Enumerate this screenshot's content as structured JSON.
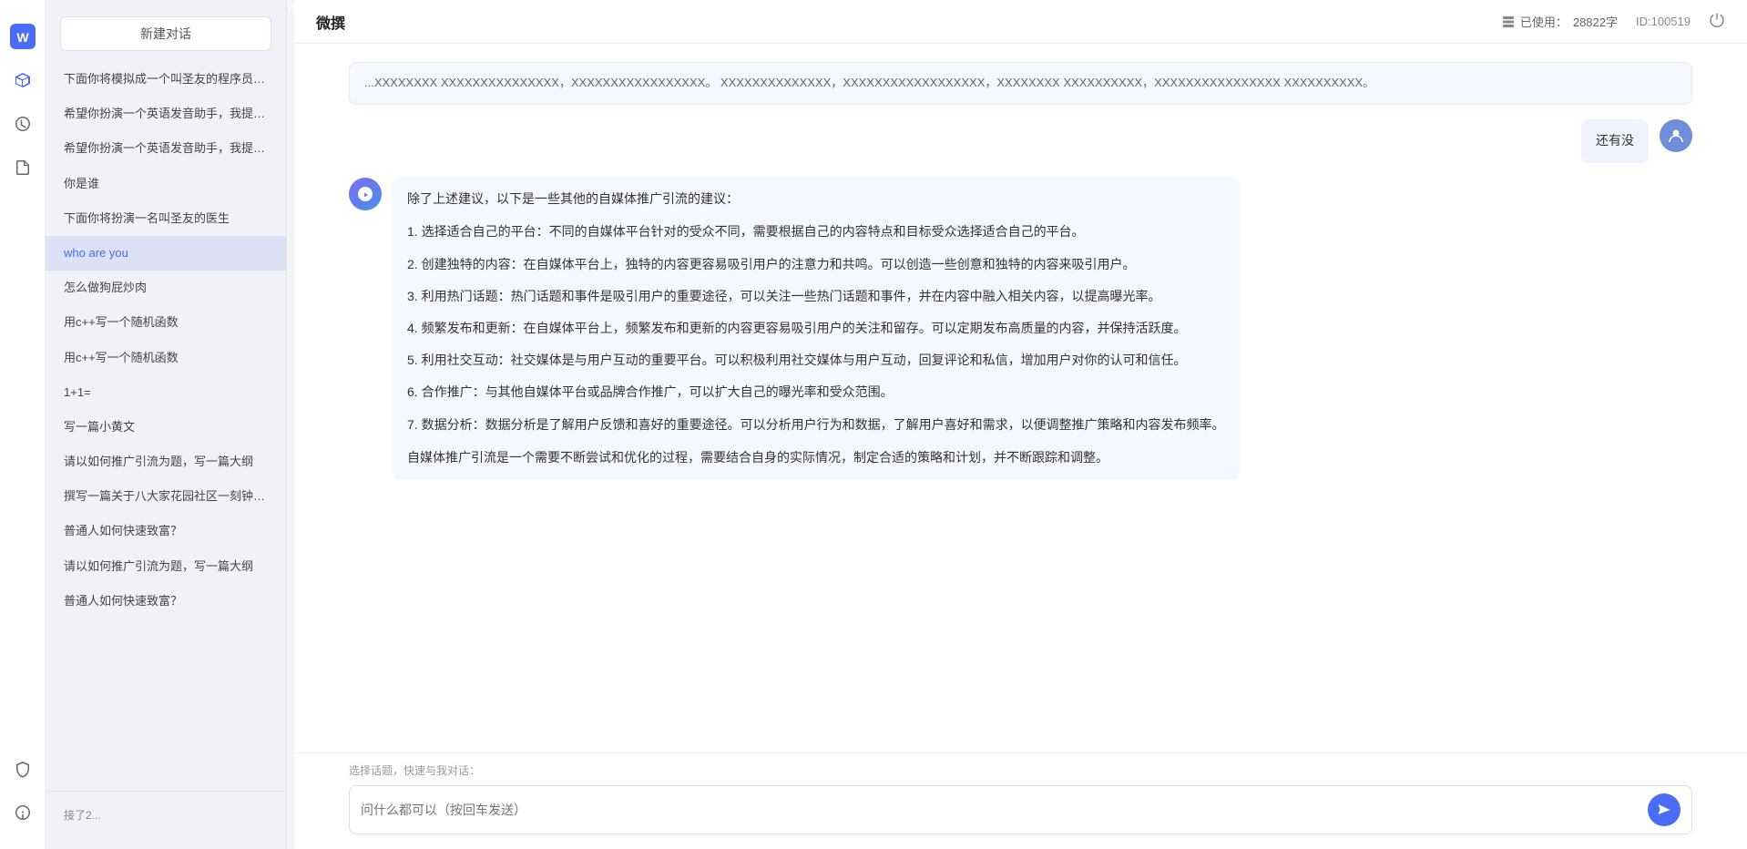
{
  "app": {
    "title": "微撰",
    "usage_label": "已使用：",
    "usage_value": "28822字",
    "id_label": "ID:100519"
  },
  "header": {
    "title": "微撰"
  },
  "sidebar": {
    "new_chat_label": "新建对话",
    "items": [
      {
        "id": 1,
        "text": "下面你将模拟成一个叫圣友的程序员，我说..."
      },
      {
        "id": 2,
        "text": "希望你扮演一个英语发音助手，我提供给你..."
      },
      {
        "id": 3,
        "text": "希望你扮演一个英语发音助手，我提供给你..."
      },
      {
        "id": 4,
        "text": "你是谁"
      },
      {
        "id": 5,
        "text": "下面你将扮演一名叫圣友的医生"
      },
      {
        "id": 6,
        "text": "who are you",
        "active": true
      },
      {
        "id": 7,
        "text": "怎么做狗屁炒肉"
      },
      {
        "id": 8,
        "text": "用c++写一个随机函数"
      },
      {
        "id": 9,
        "text": "用c++写一个随机函数"
      },
      {
        "id": 10,
        "text": "1+1="
      },
      {
        "id": 11,
        "text": "写一篇小黄文"
      },
      {
        "id": 12,
        "text": "请以如何推广引流为题，写一篇大纲"
      },
      {
        "id": 13,
        "text": "撰写一篇关于八大家花园社区一刻钟便民生..."
      },
      {
        "id": 14,
        "text": "普通人如何快速致富？"
      },
      {
        "id": 15,
        "text": "请以如何推广引流为题，写一篇大纲"
      },
      {
        "id": 16,
        "text": "普通人如何快速致富？"
      }
    ],
    "bottom_items": [
      {
        "id": "b1",
        "text": "接了2..."
      }
    ]
  },
  "chat": {
    "partial_text": "...XXXXXXXX XXXXXXXXXXXXXXX，XXXXXXXXXXXXXXXXX。 XXXXXXXXXXXXXX，XXXXXXXXXXXXXXXXXX，XXXXXXXX XXXXXXXXXX，XXXXXXXXXXXXXXXX XXXXXXXXXX。",
    "user_message": "还有没",
    "ai_response": {
      "intro": "除了上述建议，以下是一些其他的自媒体推广引流的建议：",
      "points": [
        "1. 选择适合自己的平台：不同的自媒体平台针对的受众不同，需要根据自己的内容特点和目标受众选择适合自己的平台。",
        "2. 创建独特的内容：在自媒体平台上，独特的内容更容易吸引用户的注意力和共鸣。可以创造一些创意和独特的内容来吸引用户。",
        "3. 利用热门话题：热门话题和事件是吸引用户的重要途径，可以关注一些热门话题和事件，并在内容中融入相关内容，以提高曝光率。",
        "4. 频繁发布和更新：在自媒体平台上，频繁发布和更新的内容更容易吸引用户的关注和留存。可以定期发布高质量的内容，并保持活跃度。",
        "5. 利用社交互动：社交媒体是与用户互动的重要平台。可以积极利用社交媒体与用户互动，回复评论和私信，增加用户对你的认可和信任。",
        "6. 合作推广：与其他自媒体平台或品牌合作推广，可以扩大自己的曝光率和受众范围。",
        "7. 数据分析：数据分析是了解用户反馈和喜好的重要途径。可以分析用户行为和数据，了解用户喜好和需求，以便调整推广策略和内容发布频率。"
      ],
      "conclusion": "自媒体推广引流是一个需要不断尝试和优化的过程，需要结合自身的实际情况，制定合适的策略和计划，并不断跟踪和调整。"
    }
  },
  "input": {
    "quick_select_label": "选择话题，快速与我对话：",
    "placeholder": "问什么都可以（按回车发送）"
  },
  "icons": {
    "send": "send-icon",
    "logo": "logo-icon",
    "cube": "cube-icon",
    "clock": "clock-icon",
    "document": "document-icon",
    "shield": "shield-icon",
    "info": "info-icon",
    "power": "power-icon",
    "storage": "storage-icon",
    "arrow_right": "arrow-right-icon"
  }
}
